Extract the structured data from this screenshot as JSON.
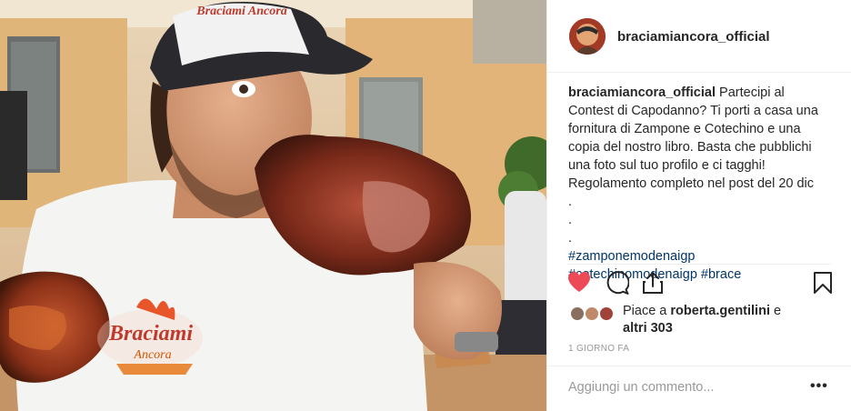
{
  "post": {
    "username": "braciamiancora_official",
    "caption_lines": [
      "Partecipi al",
      "Contest di Capodanno? Ti porti a casa una",
      "fornitura di Zampone e Cotechino e una",
      "copia del nostro libro. Basta che pubblichi",
      "una foto sul tuo profilo e ci tagghi!",
      "Regolamento completo nel post del 20 dic"
    ],
    "caption_dots": [
      ".",
      ".",
      "."
    ],
    "hashtags": {
      "tag1": "#zamponemodenaigp",
      "tag2": "#cotechinomodenaigp",
      "tag3": "#brace"
    },
    "likes": {
      "prefix": "Piace a",
      "user": "roberta.gentilini",
      "suffix": "e",
      "others": "altri 303"
    },
    "timestamp": "1 GIORNO FA",
    "comment_placeholder": "Aggiungi un commento...",
    "more_label": "•••"
  },
  "photo": {
    "shirt_logo_line1": "Braciami",
    "shirt_logo_line2": "Ancora",
    "cap_logo": "Braciami Ancora"
  },
  "icons": {
    "like": "heart-icon",
    "comment": "comment-icon",
    "share": "share-icon",
    "save": "bookmark-icon",
    "more": "more-options-icon"
  },
  "colors": {
    "heart": "#ed4956",
    "hashtag": "#003569",
    "muted": "#999999",
    "text": "#262626"
  }
}
